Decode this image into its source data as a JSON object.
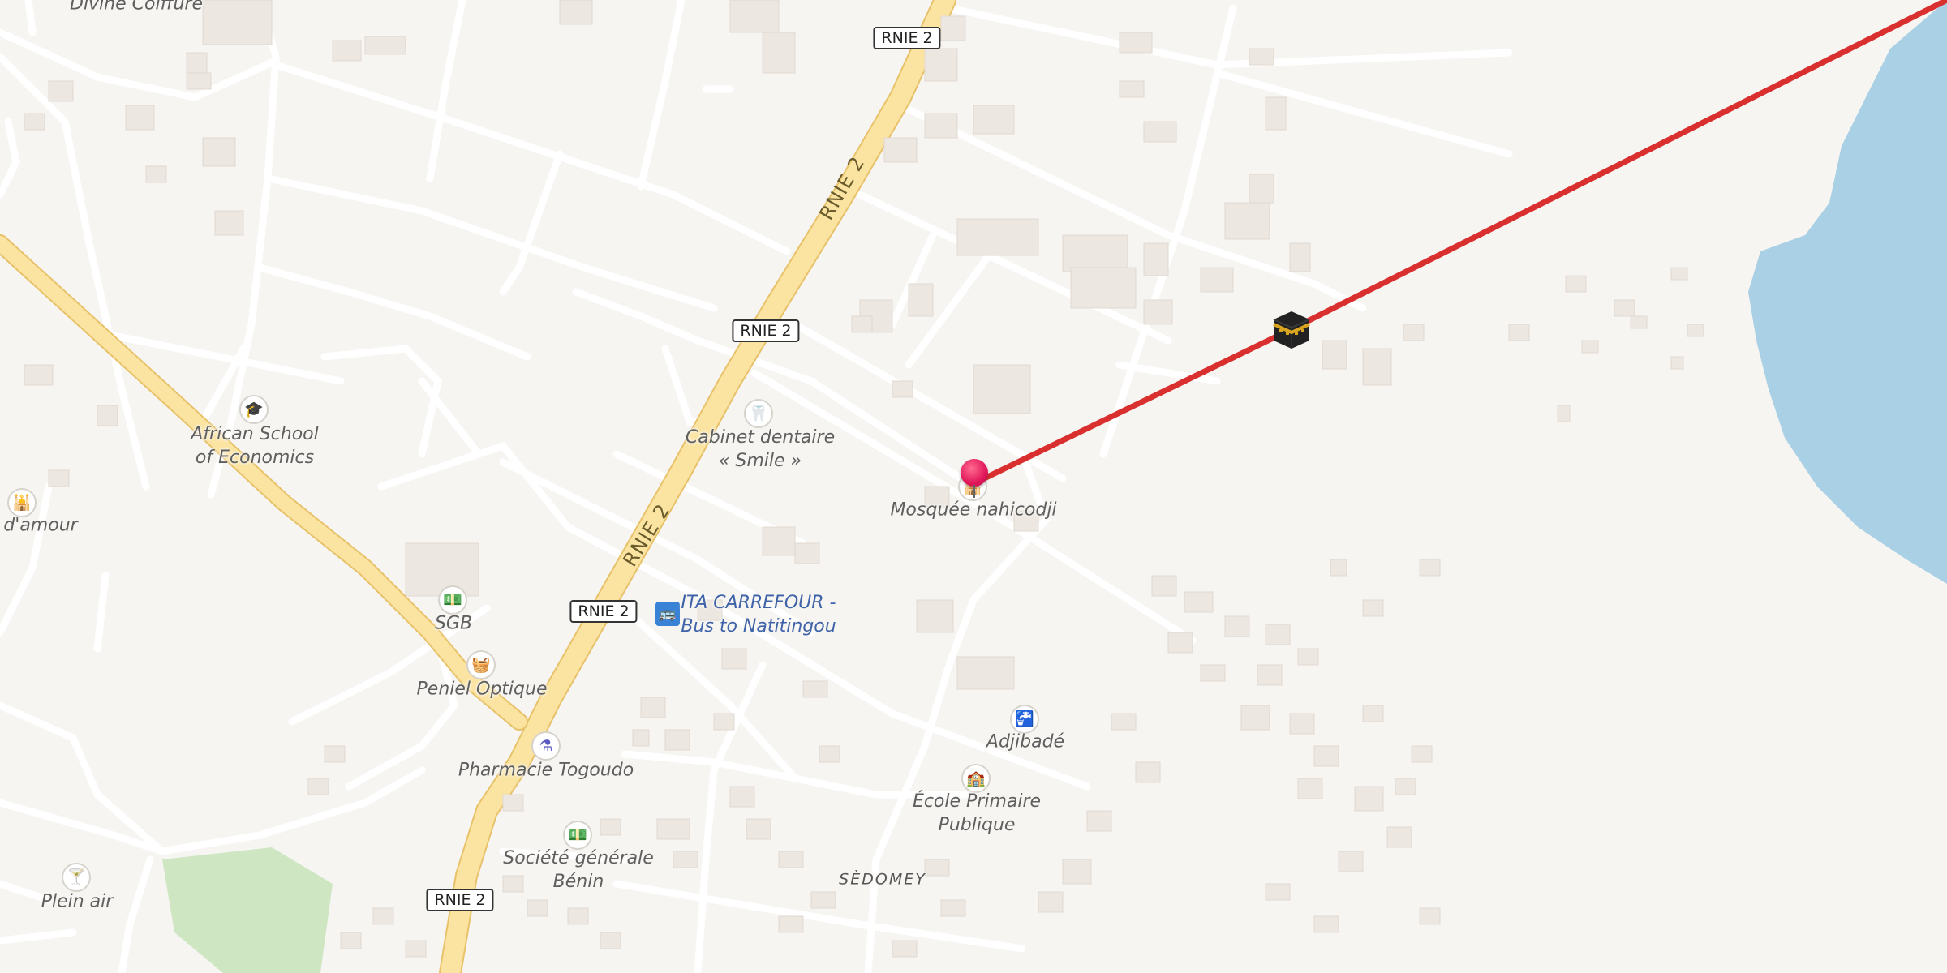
{
  "map": {
    "poi_labels": {
      "divine": "Divine Coiffure",
      "african_school": "African School\nof Economics",
      "damour": "d'amour",
      "sgb": "SGB",
      "peniel": "Peniel Optique",
      "pharmacie": "Pharmacie Togoudo",
      "societe": "Société générale\nBénin",
      "plein_air": "Plein air",
      "cabinet": "Cabinet dentaire\n« Smile »",
      "mosquee": "Mosquée nahicodji",
      "ita": "ITA CARREFOUR -\nBus to Natitingou",
      "adjibade": "Adjibadé",
      "ecole": "École Primaire\nPublique",
      "sedomey": "SÈDOMEY"
    },
    "road_shields": {
      "top": "RNIE 2",
      "middle": "RNIE 2",
      "lower": "RNIE 2",
      "bottom": "RNIE 2"
    },
    "road_names": {
      "upper": "RNIE 2",
      "lower": "RNIE 2"
    },
    "icons": {
      "school": "graduation-cap-icon",
      "dentist": "tooth-icon",
      "mosque": "mosque-icon",
      "bank": "banknote-icon",
      "shop": "shopping-basket-icon",
      "pharmacy": "mortar-pestle-icon",
      "bus": "bus-stop-icon",
      "bar": "cocktail-icon",
      "school_primary": "school-icon",
      "pin": "location-pin-icon",
      "kaaba": "kaaba-icon"
    },
    "colors": {
      "background": "#f7f5f2",
      "primary_road": "#fbe4a1",
      "water": "#a9d0e4",
      "park": "#cfe6c3",
      "qibla_line": "#d9302f",
      "pin": "#e0175a"
    }
  }
}
